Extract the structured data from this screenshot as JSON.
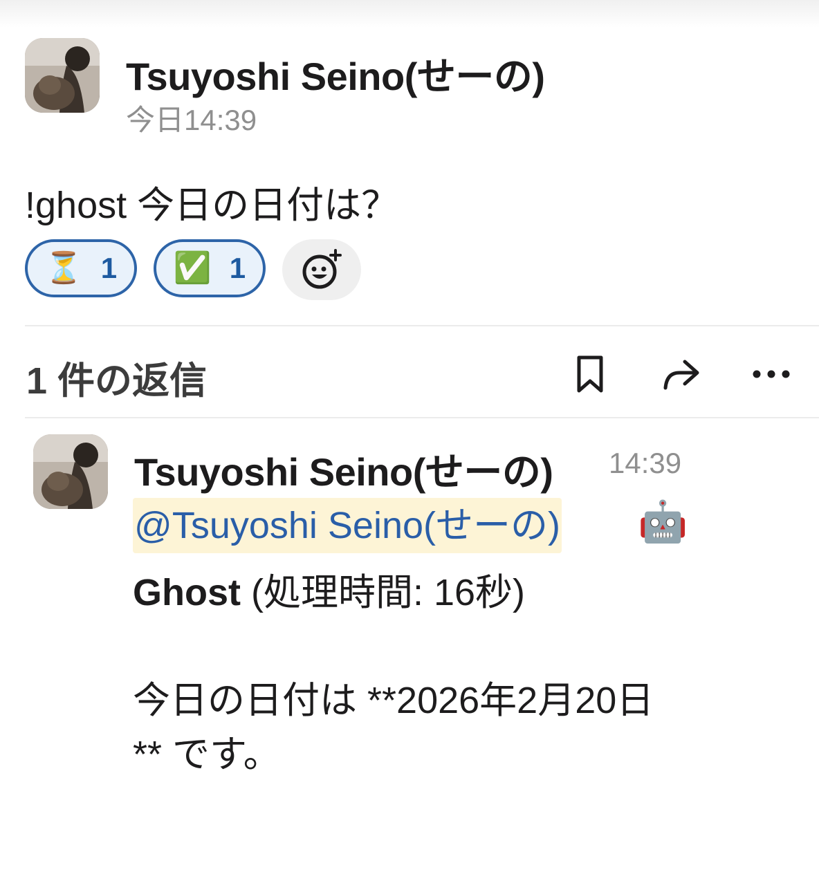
{
  "parent": {
    "author": "Tsuyoshi Seino(せーの)",
    "timestamp": "今日14:39",
    "text": "!ghost 今日の日付は？",
    "reactions": [
      {
        "emoji": "⏳",
        "count": "1"
      },
      {
        "emoji": "✅",
        "count": "1"
      }
    ]
  },
  "thread": {
    "replies_label": "1 件の返信"
  },
  "reply": {
    "author": "Tsuyoshi Seino(せーの)",
    "timestamp": "14:39",
    "mention": "@Tsuyoshi Seino(せーの)",
    "robot_emoji": "🤖",
    "bot_name": "Ghost",
    "processing": " (処理時間: 16秒)",
    "answer_line1": "今日の日付は **2026年2月20日",
    "answer_line2": "** です。"
  },
  "colors": {
    "accent_link": "#2a5ea8",
    "reaction_border": "#2d64a8",
    "mention_bg": "#fdf4d6"
  },
  "icons": [
    "add-reaction-icon",
    "bookmark-icon",
    "share-icon",
    "more-icon"
  ]
}
